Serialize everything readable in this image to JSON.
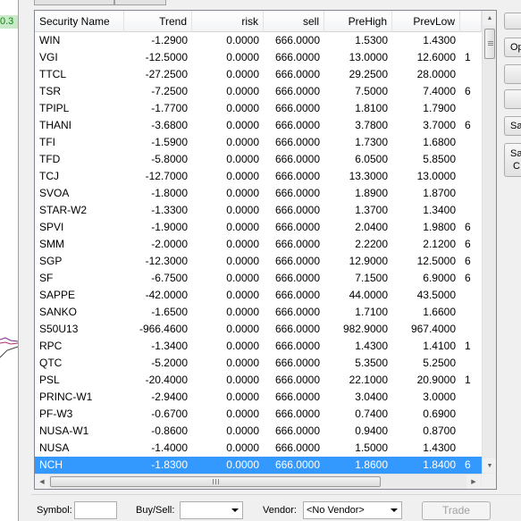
{
  "left_panel": {
    "value_text": "0.3"
  },
  "grid": {
    "columns": [
      {
        "label": "Security Name",
        "align": "left"
      },
      {
        "label": "Trend",
        "align": "right"
      },
      {
        "label": "risk",
        "align": "right"
      },
      {
        "label": "sell",
        "align": "right"
      },
      {
        "label": "PreHigh",
        "align": "right"
      },
      {
        "label": "PrevLow",
        "align": "right"
      },
      {
        "label": "",
        "align": "left"
      }
    ],
    "rows": [
      [
        "WIN",
        "-1.2900",
        "0.0000",
        "666.0000",
        "1.5300",
        "1.4300",
        ""
      ],
      [
        "VGI",
        "-12.5000",
        "0.0000",
        "666.0000",
        "13.0000",
        "12.6000",
        "1"
      ],
      [
        "TTCL",
        "-27.2500",
        "0.0000",
        "666.0000",
        "29.2500",
        "28.0000",
        ""
      ],
      [
        "TSR",
        "-7.2500",
        "0.0000",
        "666.0000",
        "7.5000",
        "7.4000",
        "6"
      ],
      [
        "TPIPL",
        "-1.7700",
        "0.0000",
        "666.0000",
        "1.8100",
        "1.7900",
        ""
      ],
      [
        "THANI",
        "-3.6800",
        "0.0000",
        "666.0000",
        "3.7800",
        "3.7000",
        "6"
      ],
      [
        "TFI",
        "-1.5900",
        "0.0000",
        "666.0000",
        "1.7300",
        "1.6800",
        ""
      ],
      [
        "TFD",
        "-5.8000",
        "0.0000",
        "666.0000",
        "6.0500",
        "5.8500",
        ""
      ],
      [
        "TCJ",
        "-12.7000",
        "0.0000",
        "666.0000",
        "13.3000",
        "13.0000",
        ""
      ],
      [
        "SVOA",
        "-1.8000",
        "0.0000",
        "666.0000",
        "1.8900",
        "1.8700",
        ""
      ],
      [
        "STAR-W2",
        "-1.3300",
        "0.0000",
        "666.0000",
        "1.3700",
        "1.3400",
        ""
      ],
      [
        "SPVI",
        "-1.9000",
        "0.0000",
        "666.0000",
        "2.0400",
        "1.9800",
        "6"
      ],
      [
        "SMM",
        "-2.0000",
        "0.0000",
        "666.0000",
        "2.2200",
        "2.1200",
        "6"
      ],
      [
        "SGP",
        "-12.3000",
        "0.0000",
        "666.0000",
        "12.9000",
        "12.5000",
        "6"
      ],
      [
        "SF",
        "-6.7500",
        "0.0000",
        "666.0000",
        "7.1500",
        "6.9000",
        "6"
      ],
      [
        "SAPPE",
        "-42.0000",
        "0.0000",
        "666.0000",
        "44.0000",
        "43.5000",
        ""
      ],
      [
        "SANKO",
        "-1.6500",
        "0.0000",
        "666.0000",
        "1.7100",
        "1.6600",
        ""
      ],
      [
        "S50U13",
        "-966.4600",
        "0.0000",
        "666.0000",
        "982.9000",
        "967.4000",
        ""
      ],
      [
        "RPC",
        "-1.3400",
        "0.0000",
        "666.0000",
        "1.4300",
        "1.4100",
        "1"
      ],
      [
        "QTC",
        "-5.2000",
        "0.0000",
        "666.0000",
        "5.3500",
        "5.2500",
        ""
      ],
      [
        "PSL",
        "-20.4000",
        "0.0000",
        "666.0000",
        "22.1000",
        "20.9000",
        "1"
      ],
      [
        "PRINC-W1",
        "-2.9400",
        "0.0000",
        "666.0000",
        "3.0400",
        "3.0000",
        ""
      ],
      [
        "PF-W3",
        "-0.6700",
        "0.0000",
        "666.0000",
        "0.7400",
        "0.6900",
        ""
      ],
      [
        "NUSA-W1",
        "-0.8600",
        "0.0000",
        "666.0000",
        "0.9400",
        "0.8700",
        ""
      ],
      [
        "NUSA",
        "-1.4000",
        "0.0000",
        "666.0000",
        "1.5000",
        "1.4300",
        ""
      ],
      [
        "NCH",
        "-1.8300",
        "0.0000",
        "666.0000",
        "1.8600",
        "1.8400",
        "6"
      ]
    ],
    "selected_row": 25
  },
  "side_buttons": [
    "",
    "Op",
    "",
    "",
    "Sa",
    "Sa",
    "C"
  ],
  "order_bar": {
    "symbol_label": "Symbol:",
    "symbol_value": "",
    "buysell_label": "Buy/Sell:",
    "buysell_value": "",
    "vendor_label": "Vendor:",
    "vendor_value": "<No Vendor>",
    "trade_label": "Trade"
  },
  "icons": {
    "scroll_up": "arrow-up-icon",
    "scroll_down": "arrow-down-icon",
    "scroll_left": "arrow-left-icon",
    "scroll_right": "arrow-right-icon"
  },
  "colors": {
    "selection": "#3399ff",
    "left_value_bg": "#c9e9c9",
    "left_value_fg": "#0a8a0a"
  }
}
